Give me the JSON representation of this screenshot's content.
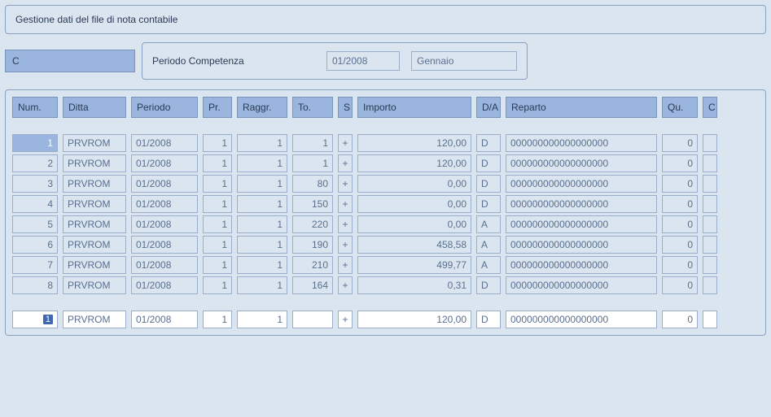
{
  "title": "Gestione dati del file di nota contabile",
  "code": "C",
  "period_label": "Periodo Competenza",
  "period_value": "01/2008",
  "period_month": "Gennaio",
  "headers": {
    "num": "Num.",
    "ditta": "Ditta",
    "periodo": "Periodo",
    "pr": "Pr.",
    "raggr": "Raggr.",
    "to": "To.",
    "s": "S",
    "importo": "Importo",
    "da": "D/A",
    "reparto": "Reparto",
    "qu": "Qu.",
    "c": "C"
  },
  "rows": [
    {
      "num": "1",
      "ditta": "PRVROM",
      "periodo": "01/2008",
      "pr": "1",
      "raggr": "1",
      "to": "1",
      "s": "+",
      "importo": "120,00",
      "da": "D",
      "reparto": "000000000000000000",
      "qu": "0",
      "c": ""
    },
    {
      "num": "2",
      "ditta": "PRVROM",
      "periodo": "01/2008",
      "pr": "1",
      "raggr": "1",
      "to": "1",
      "s": "+",
      "importo": "120,00",
      "da": "D",
      "reparto": "000000000000000000",
      "qu": "0",
      "c": ""
    },
    {
      "num": "3",
      "ditta": "PRVROM",
      "periodo": "01/2008",
      "pr": "1",
      "raggr": "1",
      "to": "80",
      "s": "+",
      "importo": "0,00",
      "da": "D",
      "reparto": "000000000000000000",
      "qu": "0",
      "c": ""
    },
    {
      "num": "4",
      "ditta": "PRVROM",
      "periodo": "01/2008",
      "pr": "1",
      "raggr": "1",
      "to": "150",
      "s": "+",
      "importo": "0,00",
      "da": "D",
      "reparto": "000000000000000000",
      "qu": "0",
      "c": ""
    },
    {
      "num": "5",
      "ditta": "PRVROM",
      "periodo": "01/2008",
      "pr": "1",
      "raggr": "1",
      "to": "220",
      "s": "+",
      "importo": "0,00",
      "da": "A",
      "reparto": "000000000000000000",
      "qu": "0",
      "c": ""
    },
    {
      "num": "6",
      "ditta": "PRVROM",
      "periodo": "01/2008",
      "pr": "1",
      "raggr": "1",
      "to": "190",
      "s": "+",
      "importo": "458,58",
      "da": "A",
      "reparto": "000000000000000000",
      "qu": "0",
      "c": ""
    },
    {
      "num": "7",
      "ditta": "PRVROM",
      "periodo": "01/2008",
      "pr": "1",
      "raggr": "1",
      "to": "210",
      "s": "+",
      "importo": "499,77",
      "da": "A",
      "reparto": "000000000000000000",
      "qu": "0",
      "c": ""
    },
    {
      "num": "8",
      "ditta": "PRVROM",
      "periodo": "01/2008",
      "pr": "1",
      "raggr": "1",
      "to": "164",
      "s": "+",
      "importo": "0,31",
      "da": "D",
      "reparto": "000000000000000000",
      "qu": "0",
      "c": ""
    }
  ],
  "edit_row": {
    "num": "1",
    "ditta": "PRVROM",
    "periodo": "01/2008",
    "pr": "1",
    "raggr": "1",
    "to": "",
    "s": "+",
    "importo": "120,00",
    "da": "D",
    "reparto": "000000000000000000",
    "qu": "0",
    "c": ""
  }
}
